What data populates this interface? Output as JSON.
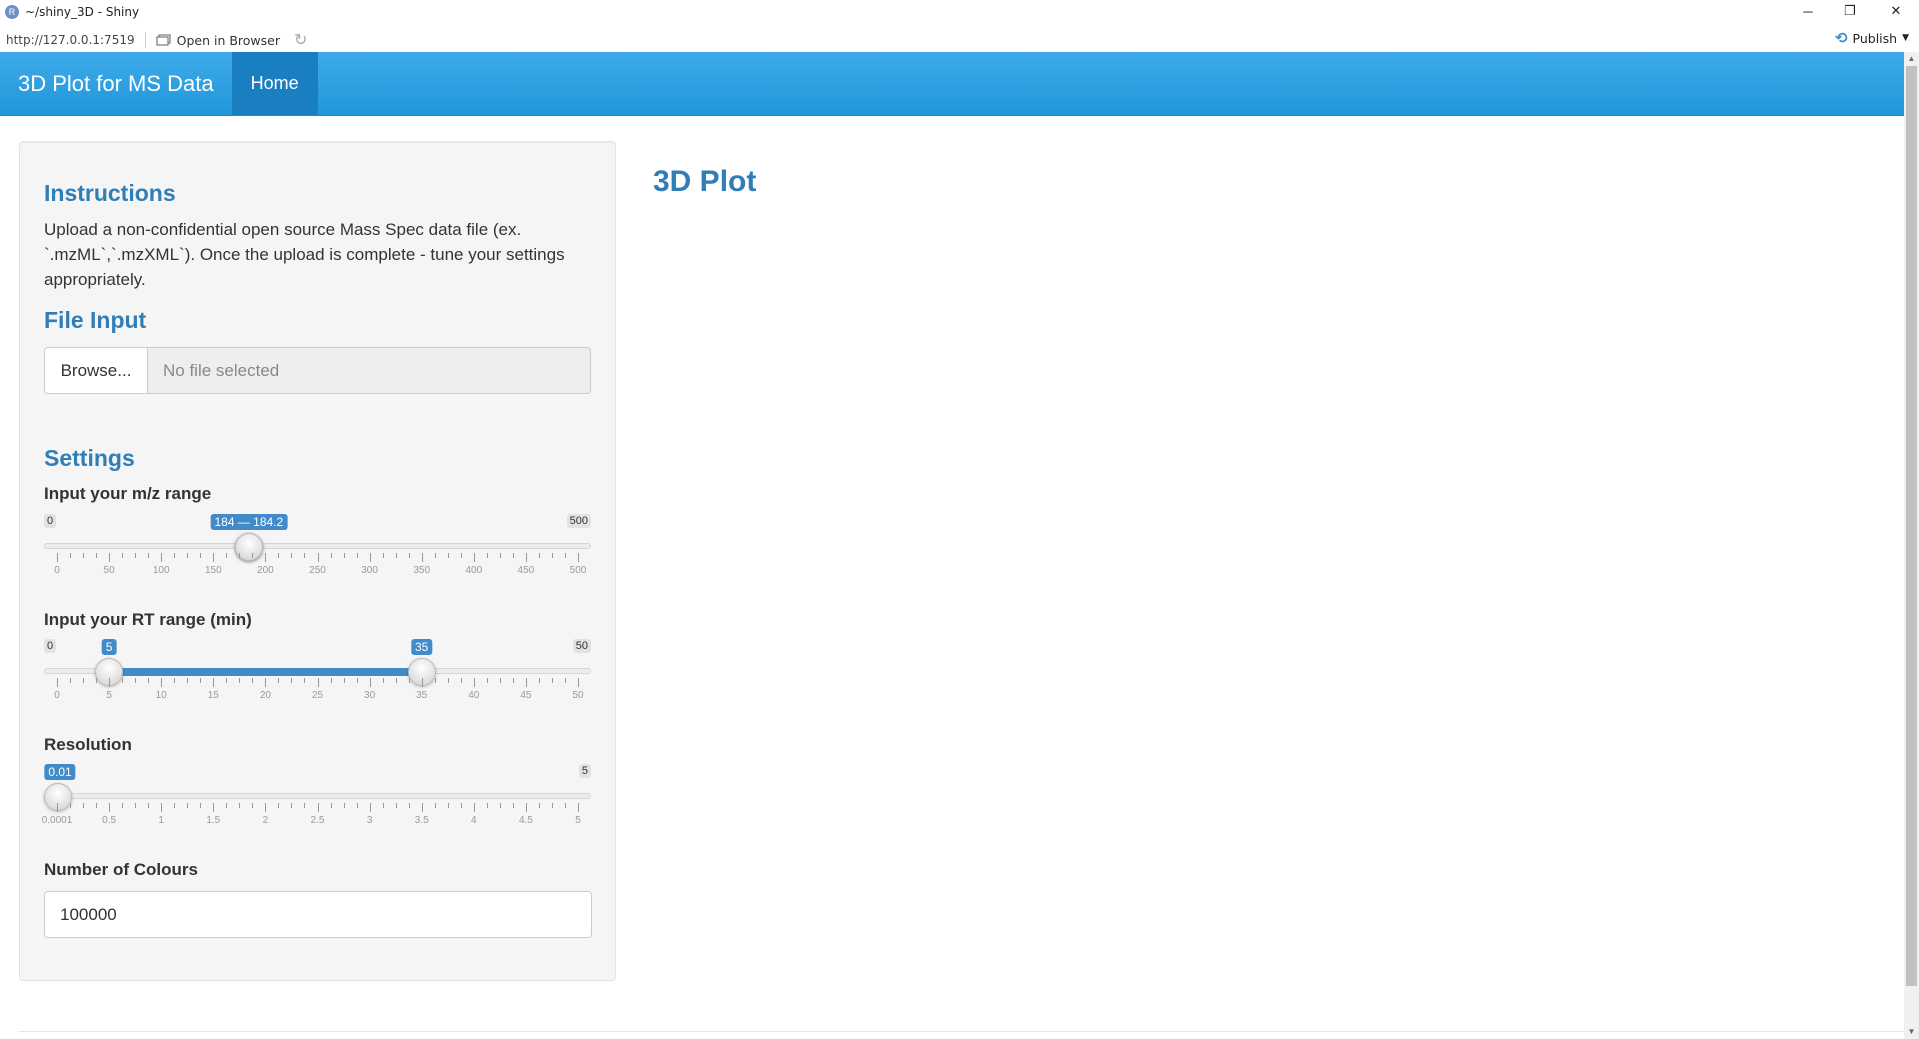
{
  "window": {
    "title": "~/shiny_3D - Shiny",
    "app_icon": "R",
    "controls": {
      "minimize": "─",
      "restore": "❐",
      "close": "✕"
    }
  },
  "toolbar": {
    "url": "http://127.0.0.1:7519",
    "open_in_browser": "Open in Browser",
    "refresh_icon": "↻",
    "publish": "Publish",
    "publish_icon": "⟲"
  },
  "navbar": {
    "brand": "3D Plot for MS Data",
    "tabs": [
      {
        "label": "Home",
        "active": true
      }
    ]
  },
  "sidebar": {
    "instructions_heading": "Instructions",
    "instructions_text": "Upload a non-confidential open source Mass Spec data file (ex. `.mzML`,`.mzXML`). Once the upload is complete - tune your settings appropriately.",
    "file_heading": "File Input",
    "browse_label": "Browse...",
    "file_placeholder": "No file selected",
    "settings_heading": "Settings",
    "mz": {
      "label": "Input your m/z range",
      "min": 0,
      "max": 500,
      "min_label": "0",
      "max_label": "500",
      "value": [
        184,
        184.2
      ],
      "value_label": "184 — 184.2",
      "ticks": [
        "0",
        "50",
        "100",
        "150",
        "200",
        "250",
        "300",
        "350",
        "400",
        "450",
        "500"
      ]
    },
    "rt": {
      "label": "Input your RT range (min)",
      "min": 0,
      "max": 50,
      "min_label": "0",
      "max_label": "50",
      "value": [
        5,
        35
      ],
      "from_label": "5",
      "to_label": "35",
      "ticks": [
        "0",
        "5",
        "10",
        "15",
        "20",
        "25",
        "30",
        "35",
        "40",
        "45",
        "50"
      ]
    },
    "resolution": {
      "label": "Resolution",
      "min": 0.0001,
      "max": 5,
      "max_label": "5",
      "value": 0.01,
      "value_label": "0.01",
      "ticks": [
        "0.0001",
        "0.5",
        "1",
        "1.5",
        "2",
        "2.5",
        "3",
        "3.5",
        "4",
        "4.5",
        "5"
      ]
    },
    "colours": {
      "label": "Number of Colours",
      "value": "100000"
    }
  },
  "main": {
    "title": "3D Plot"
  },
  "colors": {
    "navbar": "#2197dc",
    "heading": "#2f7eb8",
    "slider_accent": "#428bca"
  }
}
